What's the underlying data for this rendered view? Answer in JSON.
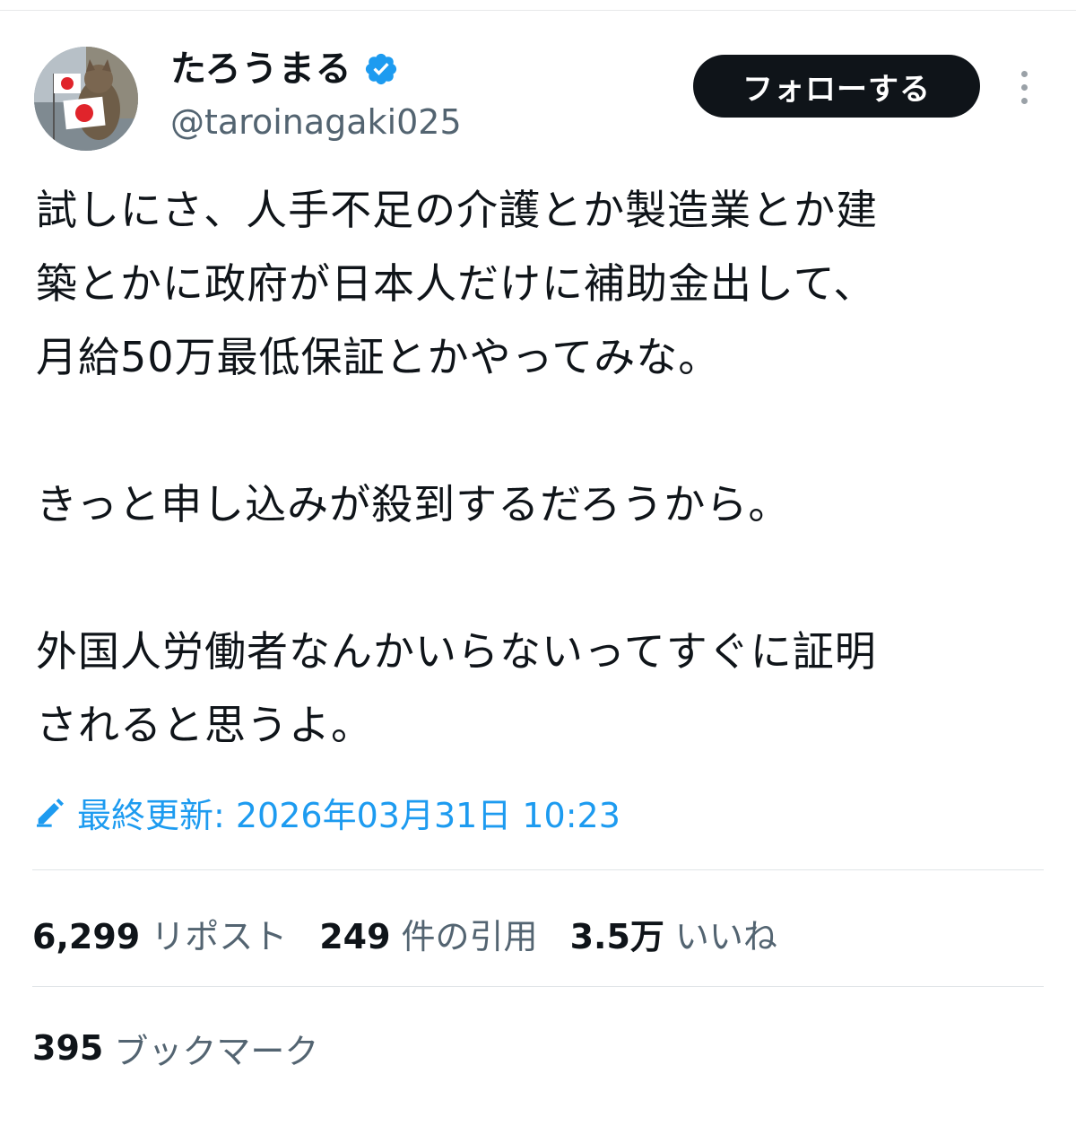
{
  "author": {
    "display_name": "たろうまる",
    "handle": "@taroinagaki025",
    "verified": true,
    "avatar_icon": "cat-with-japanese-flags-avatar"
  },
  "actions": {
    "follow_label": "フォローする",
    "more_icon": "more-vertical-icon"
  },
  "tweet": {
    "lines": [
      "試しにさ、人手不足の介護とか製造業とか建",
      "築とかに政府が日本人だけに補助金出して、",
      "月給50万最低保証とかやってみな。",
      "",
      "きっと申し込みが殺到するだろうから。",
      "",
      "外国人労働者なんかいらないってすぐに証明",
      "されると思うよ。"
    ]
  },
  "edited": {
    "icon": "pencil-icon",
    "text": "最終更新: 2026年03月31日 10:23"
  },
  "stats": [
    {
      "value": "6,299",
      "label": "リポスト"
    },
    {
      "value": "249",
      "label": "件の引用"
    },
    {
      "value": "3.5万",
      "label": "いいね"
    }
  ],
  "bookmarks": {
    "value": "395",
    "label": "ブックマーク"
  },
  "colors": {
    "text_primary": "#0f1419",
    "text_secondary": "#536471",
    "accent_blue": "#1d9bf0",
    "follow_button_bg": "#0f1419",
    "divider": "#e1e5e8"
  }
}
